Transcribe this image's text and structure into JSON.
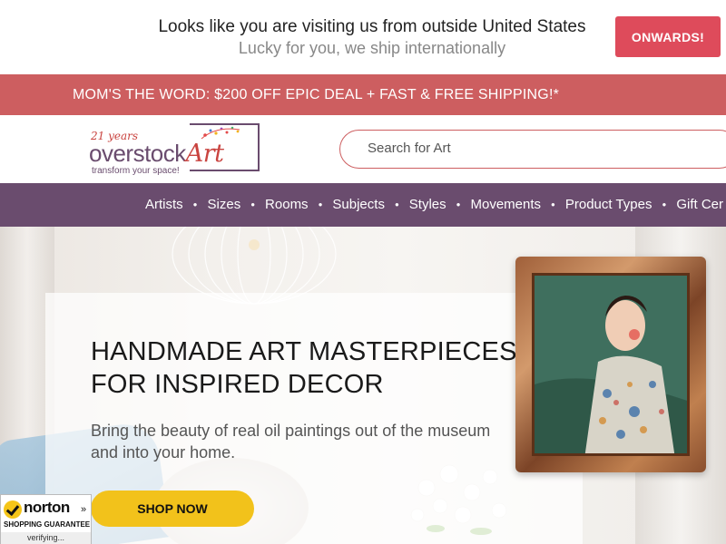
{
  "geo_banner": {
    "line1": "Looks like you are visiting us from outside United States",
    "line2": "Lucky for you, we ship internationally",
    "button_label": "ONWARDS!",
    "button_color": "#de4b5b"
  },
  "promo": {
    "text": "MOM'S THE WORD: $200 OFF EPIC DEAL + FAST & FREE SHIPPING!*",
    "background": "#cd5e60"
  },
  "logo": {
    "years": "21 years",
    "brand_main": "overstock",
    "brand_art": "Art",
    "tagline": "transform your space!"
  },
  "search": {
    "placeholder": "Search for Art"
  },
  "nav": {
    "background": "#6a4c6e",
    "items": [
      "Artists",
      "Sizes",
      "Rooms",
      "Subjects",
      "Styles",
      "Movements",
      "Product Types",
      "Gift Cer"
    ]
  },
  "hero": {
    "title_line1": "HANDMADE ART MASTERPIECES",
    "title_line2": "FOR INSPIRED DECOR",
    "subtitle": "Bring the beauty of real oil paintings out of the museum and into your home.",
    "cta_label": "SHOP NOW",
    "cta_color": "#f2c21b"
  },
  "norton_badge": {
    "name": "norton",
    "arrow": "»",
    "guarantee": "SHOPPING GUARANTEE",
    "status": "verifying..."
  }
}
